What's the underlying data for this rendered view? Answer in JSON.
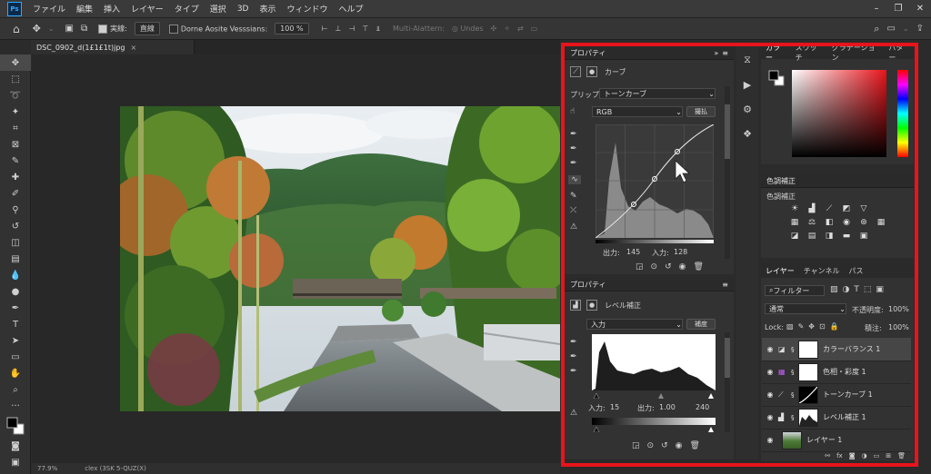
{
  "menu": {
    "logo": "Ps",
    "items": [
      "ファイル",
      "編集",
      "挿入",
      "レイヤー",
      "タイプ",
      "選択",
      "3D",
      "表示",
      "ウィンドウ",
      "ヘルプ"
    ],
    "window_controls": [
      "–",
      "❐",
      "✕"
    ]
  },
  "options": {
    "sample_label": "実線:",
    "sample_value": "直線",
    "check_label": "Dorne Aosite Vesssians:",
    "zoom_value": "100 %",
    "multi_label": "Multi-Alattern:",
    "undo_label": "Undes"
  },
  "document": {
    "tab_title": "DSC_0902_d(1£1£1t)jpg",
    "status_zoom": "77.9%",
    "status_text": "clex (3SK 5-QUZ(X)"
  },
  "curves_panel": {
    "title": "プロパティ",
    "adjustment_name": "カーブ",
    "preset_label": "プリップ:",
    "preset_value": "トーンカーブ",
    "channel_value": "RGB",
    "auto_button": "撮払",
    "output_label": "出力:",
    "output_value": "145",
    "input_label": "入力:",
    "input_value": "128"
  },
  "levels_panel": {
    "title": "プロパティ",
    "adjustment_name": "レベル補正",
    "channel_value": "入力",
    "auto_button": "補度",
    "input_label": "入力:",
    "input_black": "15",
    "output_label": "出力:",
    "gamma_value": "1.00",
    "input_white": "240"
  },
  "color_panel": {
    "tabs": [
      "カラー",
      "スウッチ",
      "グラデーション",
      "パター"
    ]
  },
  "adjustments_panel": {
    "title": "色調補正",
    "subtitle": "色調補正"
  },
  "layers_panel": {
    "tabs": [
      "レイヤー",
      "チャンネル",
      "パス"
    ],
    "filter_label": "フィルター",
    "blend_mode": "通常",
    "opacity_label": "不透明度:",
    "opacity_value": "100%",
    "lock_label": "Lock:",
    "fill_label": "積注:",
    "fill_value": "100%",
    "layers": [
      {
        "name": "カラーバランス 1"
      },
      {
        "name": "色相・彩度 1"
      },
      {
        "name": "トーンカーブ 1"
      },
      {
        "name": "レベル補正 1"
      },
      {
        "name": "レイヤー 1"
      }
    ]
  }
}
